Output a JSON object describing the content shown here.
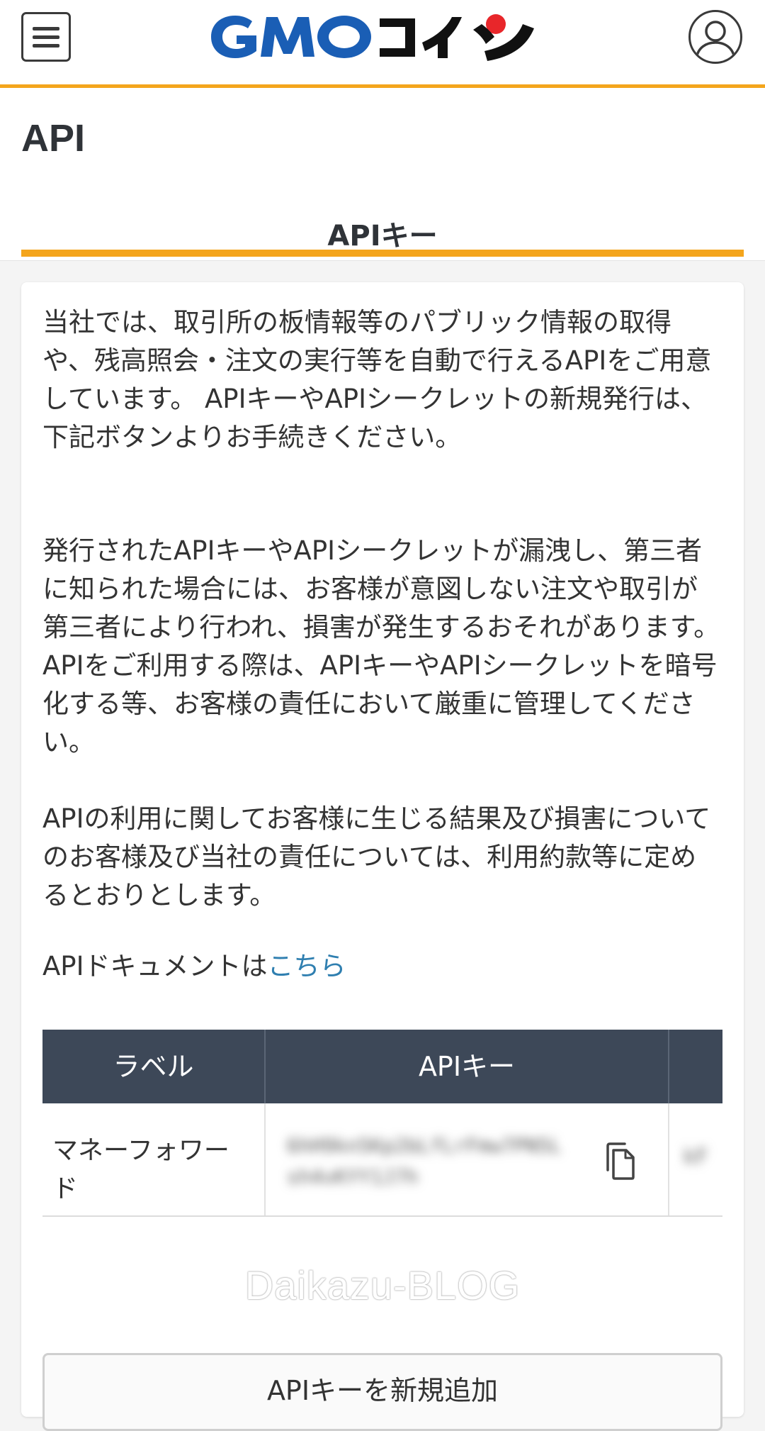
{
  "header": {
    "menu_icon": "hamburger-menu-icon",
    "logo_text": "GMOコイン",
    "user_icon": "user-account-icon"
  },
  "page": {
    "title": "API",
    "tab_label": "APIキー"
  },
  "description": {
    "p1": "当社では、取引所の板情報等のパブリック情報の取得や、残高照会・注文の実行等を自動で行えるAPIをご用意しています。 APIキーやAPIシークレットの新規発行は、下記ボタンよりお手続きください。",
    "p2": "発行されたAPIキーやAPIシークレットが漏洩し、第三者に知られた場合には、お客様が意図しない注文や取引が第三者により行われ、損害が発生するおそれがあります。 APIをご利用する際は、APIキーやAPIシークレットを暗号化する等、お客様の責任において厳重に管理してください。",
    "p3": "APIの利用に関してお客様に生じる結果及び損害についてのお客様及び当社の責任については、利用約款等に定めるとおりとします。",
    "doc_prefix": "APIドキュメントは",
    "doc_link": "こちら"
  },
  "table": {
    "headers": [
      "ラベル",
      "APIキー",
      ""
    ],
    "rows": [
      {
        "label": "マネーフォワード",
        "api_key": "6hH9kn5Kp2bLfLrFmw7PN5Lsh4vKYY1J7h",
        "secret": "kF"
      }
    ],
    "copy_icon": "copy-icon"
  },
  "watermark": "Daikazu-BLOG",
  "actions": {
    "add_key_label": "APIキーを新規追加"
  },
  "colors": {
    "accent": "#f4a51c",
    "table_header": "#3d4858",
    "link": "#2f7fb0",
    "logo_blue": "#1a5eb5",
    "logo_red": "#e8262a"
  }
}
